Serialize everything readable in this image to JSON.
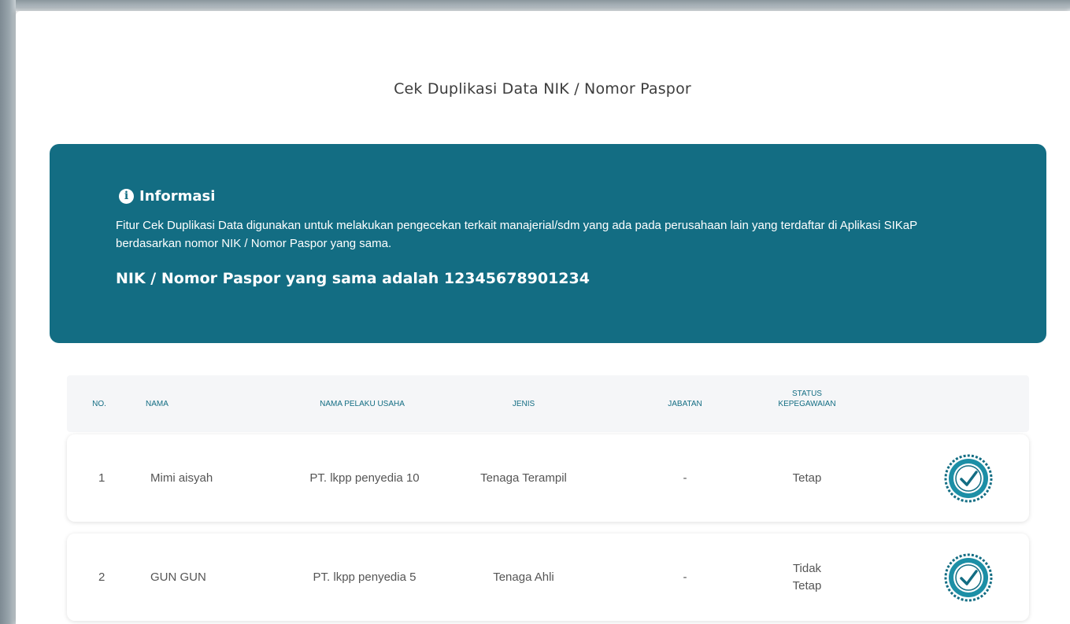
{
  "page": {
    "title": "Cek Duplikasi Data NIK / Nomor Paspor"
  },
  "info": {
    "icon": "info-circle-icon",
    "title": "Informasi",
    "text": "Fitur Cek Duplikasi Data digunakan untuk melakukan pengecekan terkait manajerial/sdm yang ada pada perusahaan lain yang terdaftar di Aplikasi SIKaP berdasarkan nomor NIK / Nomor Paspor yang sama.",
    "nik_line": "NIK / Nomor Paspor yang sama adalah 12345678901234",
    "color": "#136d83"
  },
  "table": {
    "headers": {
      "no": "NO.",
      "nama": "NAMA",
      "pelaku": "NAMA PELAKU USAHA",
      "jenis": "JENIS",
      "jabatan": "JABATAN",
      "status": "STATUS KEPEGAWAIAN"
    },
    "rows": [
      {
        "no": "1",
        "nama": "Mimi aisyah",
        "pelaku": "PT. lkpp penyedia 10",
        "jenis": "Tenaga Terampil",
        "jabatan": "-",
        "status": "Tetap",
        "action_icon": "verified-check-badge-icon"
      },
      {
        "no": "2",
        "nama": "GUN GUN",
        "pelaku": "PT. lkpp penyedia 5",
        "jenis": "Tenaga Ahli",
        "jabatan": "-",
        "status": "Tidak Tetap",
        "action_icon": "verified-check-badge-icon"
      }
    ]
  }
}
